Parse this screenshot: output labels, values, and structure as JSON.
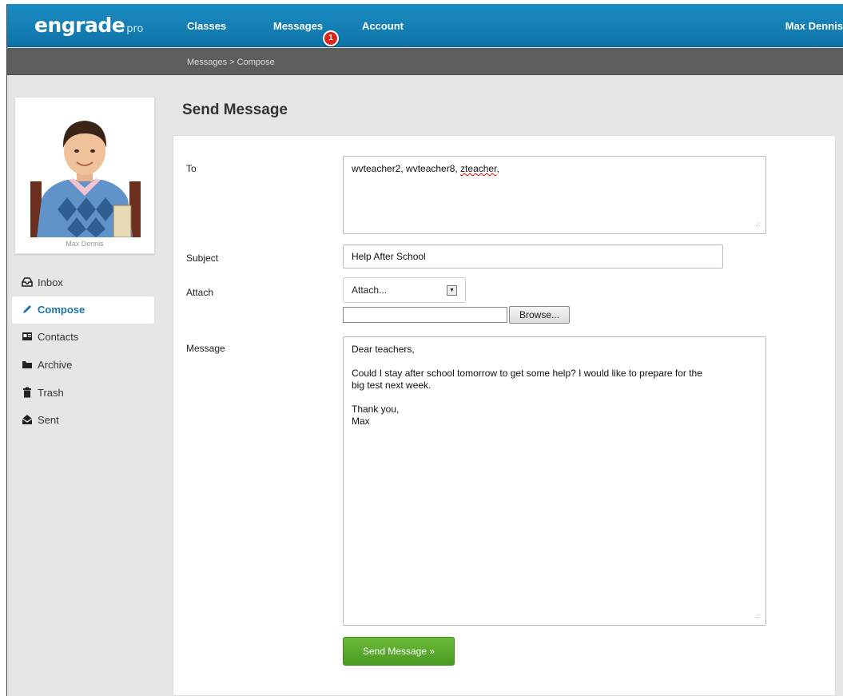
{
  "header": {
    "logo_text": "engrade",
    "logo_suffix": "pro",
    "nav": [
      "Classes",
      "Messages",
      "Account"
    ],
    "messages_badge": "1",
    "user_name": "Max Dennis",
    "accent": "#1a8cc2"
  },
  "breadcrumb": "Messages > Compose",
  "profile": {
    "name": "Max Dennis"
  },
  "sidebar": {
    "items": [
      {
        "label": "Inbox",
        "icon": "inbox-icon"
      },
      {
        "label": "Compose",
        "icon": "pencil-icon",
        "active": true
      },
      {
        "label": "Contacts",
        "icon": "contacts-icon"
      },
      {
        "label": "Archive",
        "icon": "folder-icon"
      },
      {
        "label": "Trash",
        "icon": "trash-icon"
      },
      {
        "label": "Sent",
        "icon": "sent-icon"
      }
    ]
  },
  "page_title": "Send Message",
  "form": {
    "to_label": "To",
    "to_value_plain": "wvteacher2, wvteacher8, ",
    "to_value_flagged": "zteacher",
    "to_value_end": ",",
    "subject_label": "Subject",
    "subject_value": "Help After School",
    "attach_label": "Attach",
    "attach_select": "Attach...",
    "browse_label": "Browse...",
    "message_label": "Message",
    "message_lines": [
      "Dear teachers,",
      "",
      "Could I stay after school tomorrow to get some help? I would like to prepare for the",
      "big test next week.",
      "",
      "Thank you,",
      "Max"
    ],
    "send_label": "Send Message »",
    "send_color": "#5aab2e"
  }
}
